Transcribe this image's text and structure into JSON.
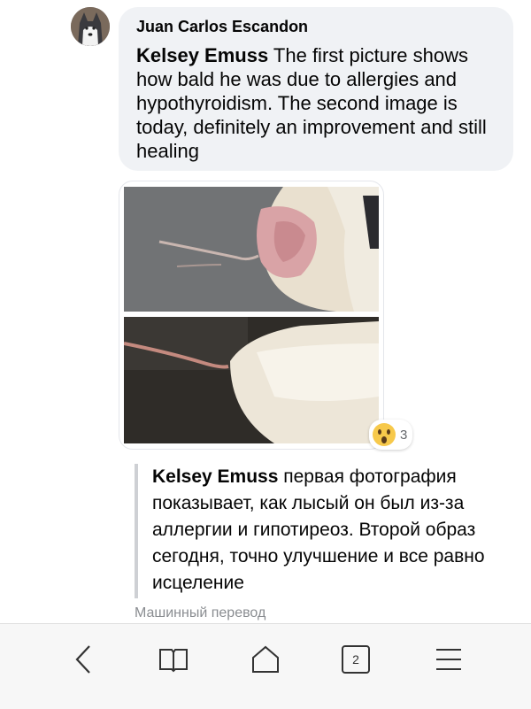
{
  "comment": {
    "author": "Juan Carlos Escandon",
    "mention": "Kelsey Emuss",
    "text": " The first picture shows how bald he was due to allergies and hypothyroidism. The second image is today, definitely an improvement and still healing"
  },
  "reaction": {
    "icon": "wow-emoji-icon",
    "count": "3"
  },
  "translation": {
    "mention": "Kelsey Emuss",
    "text": " первая фотография показывает, как лысый он был из-за аллергии и гипотиреоз. Второй образ сегодня, точно улучшение и все равно исцеление",
    "label": "Машинный перевод"
  },
  "browser_nav": {
    "tab_count": "2",
    "icons": [
      "back-icon",
      "bookmarks-icon",
      "home-icon",
      "tabs-icon",
      "menu-icon"
    ]
  },
  "colors": {
    "bubble": "#f0f2f5",
    "border": "#ced0d4",
    "muted": "#8a8d91"
  }
}
